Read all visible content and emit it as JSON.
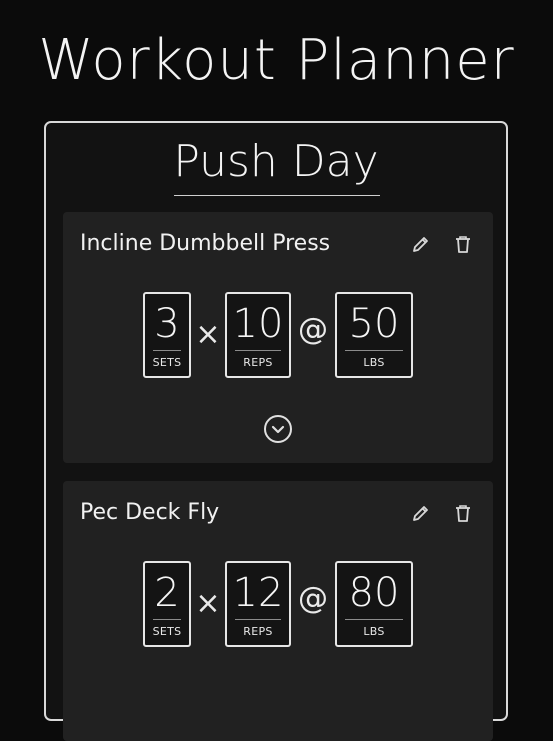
{
  "app": {
    "title": "Workout Planner"
  },
  "day": {
    "title": "Push Day"
  },
  "exercises": [
    {
      "name": "Incline Dumbbell Press",
      "sets": "3",
      "reps": "10",
      "weight": "50",
      "sets_label": "SETS",
      "reps_label": "REPS",
      "weight_label": "LBS",
      "times": "×",
      "at": "@"
    },
    {
      "name": "Pec Deck Fly",
      "sets": "2",
      "reps": "12",
      "weight": "80",
      "sets_label": "SETS",
      "reps_label": "REPS",
      "weight_label": "LBS",
      "times": "×",
      "at": "@"
    }
  ],
  "icons": {
    "edit": "pencil-icon",
    "delete": "trash-icon",
    "expand": "chevron-down-circle-icon"
  },
  "colors": {
    "background": "#0b0b0b",
    "card": "#121212",
    "exercise_card": "#212121",
    "border": "#d9d9d9"
  }
}
